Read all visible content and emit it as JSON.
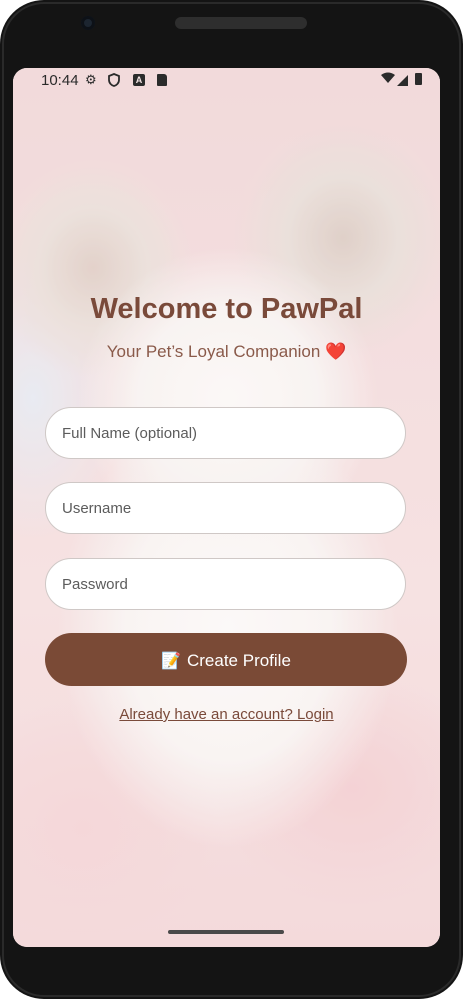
{
  "status_bar": {
    "time": "10:44",
    "icons": [
      "gear-icon",
      "shield-icon",
      "a-badge-icon",
      "sdcard-icon",
      "wifi-icon",
      "signal-icon",
      "battery-icon"
    ]
  },
  "header": {
    "title": "Welcome to PawPal",
    "subtitle": "Your Pet’s Loyal Companion",
    "subtitle_emoji": "❤️"
  },
  "form": {
    "full_name_placeholder": "Full Name (optional)",
    "username_placeholder": "Username",
    "password_placeholder": "Password",
    "create_button_emoji": "📝",
    "create_button_label": "Create Profile",
    "login_link": "Already have an account? Login"
  },
  "colors": {
    "title": "#7a4a3a",
    "button_bg": "#7a4a36",
    "button_text": "#ffffff",
    "heart": "#e0243a"
  }
}
